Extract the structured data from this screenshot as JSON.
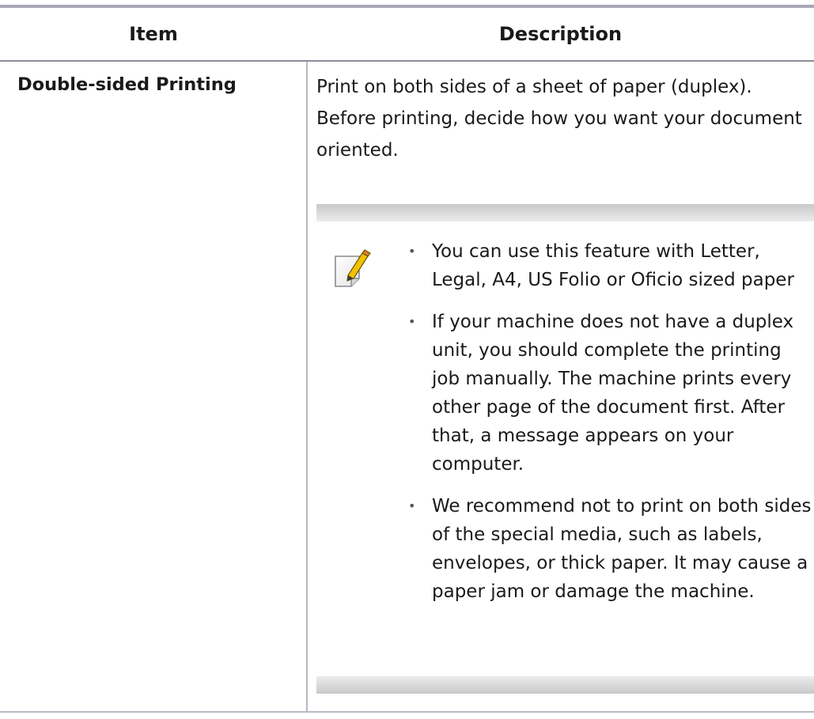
{
  "table": {
    "headers": {
      "item": "Item",
      "description": "Description"
    },
    "rows": [
      {
        "item": "Double-sided Printing",
        "description": "Print on both sides of a sheet of paper (duplex). Before printing, decide how you want your document oriented.",
        "note": {
          "icon": "note-pencil-icon",
          "bullets": [
            "You can use this feature with Letter, Legal, A4, US Folio or Oficio sized paper",
            "If your machine does not have a duplex unit, you should complete the printing job manually. The machine prints every other page of the document first. After that, a message appears on your computer.",
            "We recommend not to print on both sides of the special media, such as labels, envelopes, or thick paper. It may cause a paper jam or damage the machine."
          ]
        }
      }
    ]
  },
  "colors": {
    "rule": "#a8a8b8",
    "note_bar": "#c9c9c9",
    "text": "#1a1a1a",
    "icon_accent": "#f2c200"
  }
}
